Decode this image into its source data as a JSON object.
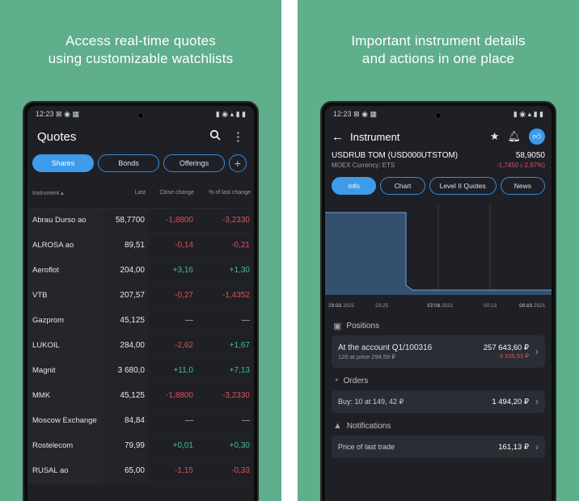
{
  "left_panel": {
    "headline_line1": "Access real-time quotes",
    "headline_line2": "using customizable watchlists",
    "status_time": "12:23",
    "status_left_icons": "⊠ ◉ ▦",
    "status_right_icons": "▮ ◉ ▴ ▮ ▮",
    "screen_title": "Quotes",
    "chips": [
      "Shares",
      "Bonds",
      "Offerings"
    ],
    "table": {
      "headers": [
        "Instrument",
        "Last",
        "Close change",
        "% of last change"
      ],
      "rows": [
        [
          "Abrau Durso ao",
          "58,7700",
          "-1,8800",
          "-3,2330"
        ],
        [
          "ALROSA ao",
          "89,51",
          "-0,14",
          "-0,21"
        ],
        [
          "Aeroflot",
          "204,00",
          "+3,16",
          "+1,30"
        ],
        [
          "VTB",
          "207,57",
          "-0,27",
          "-1,4352"
        ],
        [
          "Gazprom",
          "45,125",
          "—",
          "—"
        ],
        [
          "LUKOIL",
          "284,00",
          "-2,62",
          "+1,67"
        ],
        [
          "Magnit",
          "3 680,0",
          "+11,0",
          "+7,13"
        ],
        [
          "MMK",
          "45,125",
          "-1,8800",
          "-3,2330"
        ],
        [
          "Moscow Exchange",
          "84,84",
          "—",
          "—"
        ],
        [
          "Rostelecom",
          "79,99",
          "+0,01",
          "+0,30"
        ],
        [
          "RUSAL ao",
          "65,00",
          "-1,15",
          "-0,33"
        ]
      ]
    }
  },
  "right_panel": {
    "headline_line1": "Important instrument details",
    "headline_line2": "and actions in one place",
    "status_time": "12:23",
    "status_left_icons": "⊠ ◉ ▦",
    "status_right_icons": "▮ ◉ ▴ ▮ ▮",
    "screen_title": "Instrument",
    "instrument_name": "USDRUB TOM (USD000UTSTOM)",
    "instrument_price": "58,9050",
    "instrument_exchange": "MOEX Currency: ETS",
    "instrument_change": "-1,7450 (-2,97%)",
    "tabs": [
      "Info",
      "Chart",
      "Level II Quotes",
      "News"
    ],
    "chart_ticks": [
      {
        "t": "23:23",
        "d": "20.01.2021"
      },
      {
        "t": "23:25",
        "d": ""
      },
      {
        "t": "17:00",
        "d": "23.01.2021"
      },
      {
        "t": "00:13",
        "d": ""
      },
      {
        "t": "00:13",
        "d": "23.01.2021"
      }
    ],
    "positions_title": "Positions",
    "position_account": "At the account Q1/100316",
    "position_detail": "120 at price 294,59 ₽",
    "position_value": "257 643,60 ₽",
    "position_change": "-3 535,53 ₽",
    "orders_title": "Orders",
    "order_text": "Buy: 10 at 149, 42 ₽",
    "order_value": "1 494,20 ₽",
    "notifications_title": "Notifications",
    "notification_text": "Price of last trade",
    "notification_value": "161,13 ₽"
  },
  "colors": {
    "background": "#5fae8c",
    "screen": "#1e2026",
    "accent": "#3d9be9",
    "negative": "#e0505a",
    "positive": "#3ec28a"
  }
}
